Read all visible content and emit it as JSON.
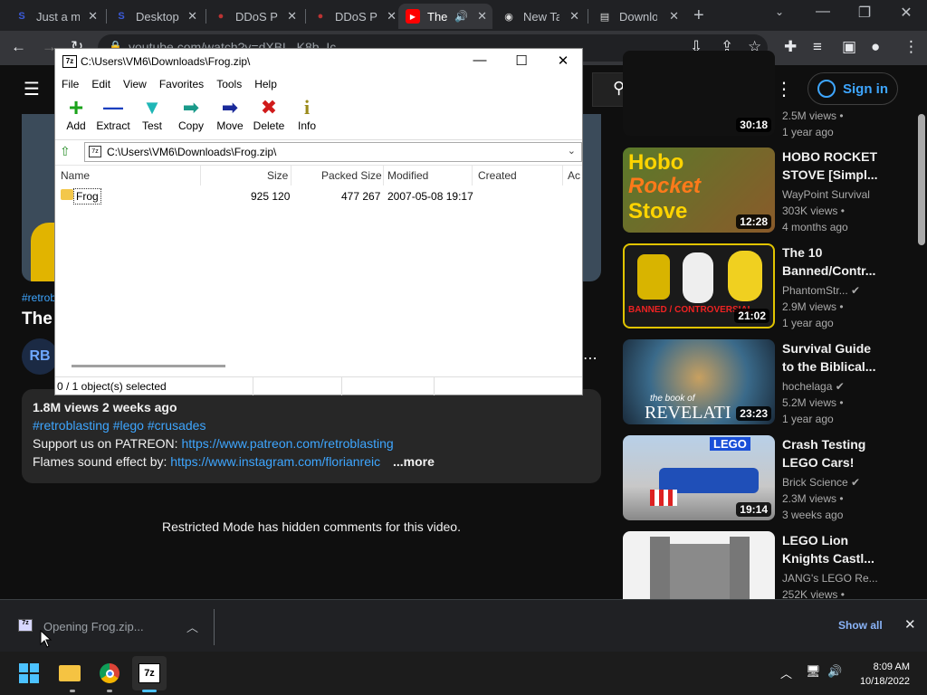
{
  "browser": {
    "tabs": [
      {
        "title": "Just a m",
        "favicon": "S",
        "color": "#3b5bdb"
      },
      {
        "title": "Desktop",
        "favicon": "S",
        "color": "#3b5bdb"
      },
      {
        "title": "DDoS P",
        "favicon": "●",
        "color": "#b33"
      },
      {
        "title": "DDoS P",
        "favicon": "●",
        "color": "#b33"
      },
      {
        "title": "The",
        "favicon": "▶",
        "color": "#f00"
      },
      {
        "title": "New Tab",
        "favicon": "◉",
        "color": "#ddd"
      },
      {
        "title": "Downlo",
        "favicon": "▤",
        "color": "#ddd"
      }
    ],
    "url": "youtube.com/watch?v=dXBL_K8b_Ic",
    "window_controls": {
      "min": "—",
      "restore": "❐",
      "close": "✕"
    }
  },
  "youtube": {
    "signin_label": "Sign in",
    "hashtag_top": "#retrob",
    "title_partial": "The",
    "channel_avatar": "RB",
    "description": {
      "views_age": "1.8M views  2 weeks ago",
      "hashtags": "#retroblasting #lego #crusades",
      "patreon_prefix": "Support us on PATREON: ",
      "patreon_link": "https://www.patreon.com/retroblasting",
      "flames_prefix": "Flames sound effect by: ",
      "flames_link": "https://www.instagram.com/florianreic",
      "more": "...more"
    },
    "restricted": "Restricted Mode has hidden comments for this video.",
    "recommendations": [
      {
        "title": [
          "",
          ""
        ],
        "channel": "",
        "views": "2.5M views",
        "age": "1 year ago",
        "duration": "30:18",
        "thumb_text": "",
        "thumb_color": "#222"
      },
      {
        "title": [
          "HOBO ROCKET",
          "STOVE [Simpl..."
        ],
        "channel": "WayPoint Survival",
        "views": "303K views",
        "age": "4 months ago",
        "duration": "12:28",
        "thumb_text": "Hobo\nRocket\nStove",
        "thumb_color": "#4a6a2a"
      },
      {
        "title": [
          "The 10",
          "Banned/Contr..."
        ],
        "channel": "PhantomStr...",
        "views": "2.9M views",
        "age": "1 year ago",
        "duration": "21:02",
        "thumb_text": "BANNED / CONTROVERSIAL\nLEGO Sets",
        "thumb_color": "#1e1e1e"
      },
      {
        "title": [
          "Survival Guide",
          "to the Biblical..."
        ],
        "channel": "hochelaga",
        "views": "5.2M views",
        "age": "1 year ago",
        "duration": "23:23",
        "thumb_text": "the book of\nREVELATI",
        "thumb_color": "#2d5a7a"
      },
      {
        "title": [
          "Crash Testing",
          "LEGO Cars!"
        ],
        "channel": "Brick Science",
        "views": "2.3M views",
        "age": "3 weeks ago",
        "duration": "19:14",
        "thumb_text": "LEGO",
        "thumb_color": "#9ab"
      },
      {
        "title": [
          "LEGO Lion",
          "Knights Castl..."
        ],
        "channel": "JANG's LEGO Re...",
        "views": "252K views",
        "age": "",
        "duration": "",
        "thumb_text": "",
        "thumb_color": "#ddd"
      }
    ]
  },
  "download_bar": {
    "item_label": "Opening Frog.zip...",
    "show_all": "Show all"
  },
  "taskbar": {
    "time": "8:09 AM",
    "date": "10/18/2022"
  },
  "sevenzip": {
    "title": "C:\\Users\\VM6\\Downloads\\Frog.zip\\",
    "menu": [
      "File",
      "Edit",
      "View",
      "Favorites",
      "Tools",
      "Help"
    ],
    "tools": [
      {
        "label": "Add",
        "icon": "+",
        "color": "#1aa31a"
      },
      {
        "label": "Extract",
        "icon": "—",
        "color": "#1a3fbf"
      },
      {
        "label": "Test",
        "icon": "▼",
        "color": "#1fb6b6"
      },
      {
        "label": "Copy",
        "icon": "➡",
        "color": "#1a9a8a"
      },
      {
        "label": "Move",
        "icon": "➡",
        "color": "#1a2a9a"
      },
      {
        "label": "Delete",
        "icon": "✖",
        "color": "#d01a1a"
      },
      {
        "label": "Info",
        "icon": "i",
        "color": "#9a8a1a"
      }
    ],
    "path": "C:\\Users\\VM6\\Downloads\\Frog.zip\\",
    "columns": [
      "Name",
      "Size",
      "Packed Size",
      "Modified",
      "Created",
      "Ac"
    ],
    "rows": [
      {
        "name": "Frog",
        "size": "925 120",
        "packed": "477 267",
        "modified": "2007-05-08 19:17",
        "created": ""
      }
    ],
    "status": "0 / 1 object(s) selected"
  }
}
